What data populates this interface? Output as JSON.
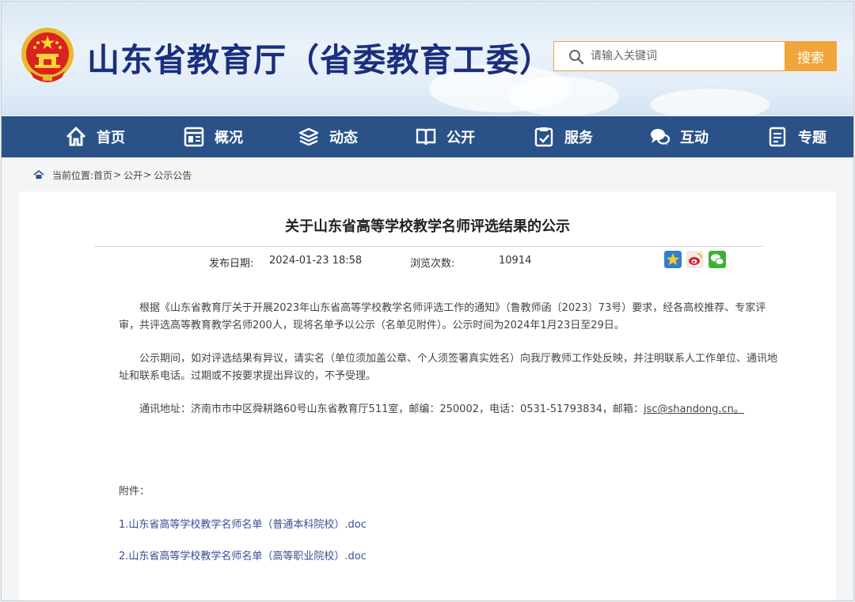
{
  "header": {
    "site_title": "山东省教育厅（省委教育工委）",
    "search": {
      "placeholder": "请输入关键词",
      "button_label": "搜索"
    }
  },
  "nav": {
    "items": [
      {
        "label": "首页",
        "icon": "home-icon"
      },
      {
        "label": "概况",
        "icon": "window-icon"
      },
      {
        "label": "动态",
        "icon": "stack-icon"
      },
      {
        "label": "公开",
        "icon": "book-icon"
      },
      {
        "label": "服务",
        "icon": "service-icon"
      },
      {
        "label": "互动",
        "icon": "chat-icon"
      },
      {
        "label": "专题",
        "icon": "document-icon"
      }
    ]
  },
  "breadcrumb": {
    "prefix": "当前位置:",
    "items": [
      "首页",
      "公开",
      "公示公告"
    ],
    "separator": ">"
  },
  "article": {
    "title": "关于山东省高等学校教学名师评选结果的公示",
    "publish_label": "发布日期:",
    "publish_date": "2024-01-23 18:58",
    "views_label": "浏览次数:",
    "views": "10914",
    "share_icons": [
      "qzone-star-icon",
      "weibo-icon",
      "wechat-icon"
    ],
    "paragraphs": [
      "根据《山东省教育厅关于开展2023年山东省高等学校教学名师评选工作的通知》（鲁教师函〔2023〕73号）要求，经各高校推荐、专家评审，共评选高等教育教学名师200人，现将名单予以公示（名单见附件）。公示时间为2024年1月23日至29日。",
      "公示期间，如对评选结果有异议，请实名（单位须加盖公章、个人须签署真实姓名）向我厅教师工作处反映，并注明联系人工作单位、通讯地址和联系电话。过期或不按要求提出异议的，不予受理。"
    ],
    "contact_prefix": "通讯地址：济南市市中区舜耕路60号山东省教育厅511室，邮编：250002，电话：0531-51793834，邮箱：",
    "contact_email": "jsc@shandong.cn。",
    "attachments_label": "附件：",
    "attachments": [
      "1.山东省高等学校教学名师名单（普通本科院校）.doc",
      "2.山东省高等学校教学名师名单（高等职业院校）.doc"
    ]
  },
  "colors": {
    "nav_bg": "#2a5289",
    "title_blue": "#1a2f7e",
    "search_accent": "#f2a53a",
    "link_blue": "#3a4d93"
  }
}
